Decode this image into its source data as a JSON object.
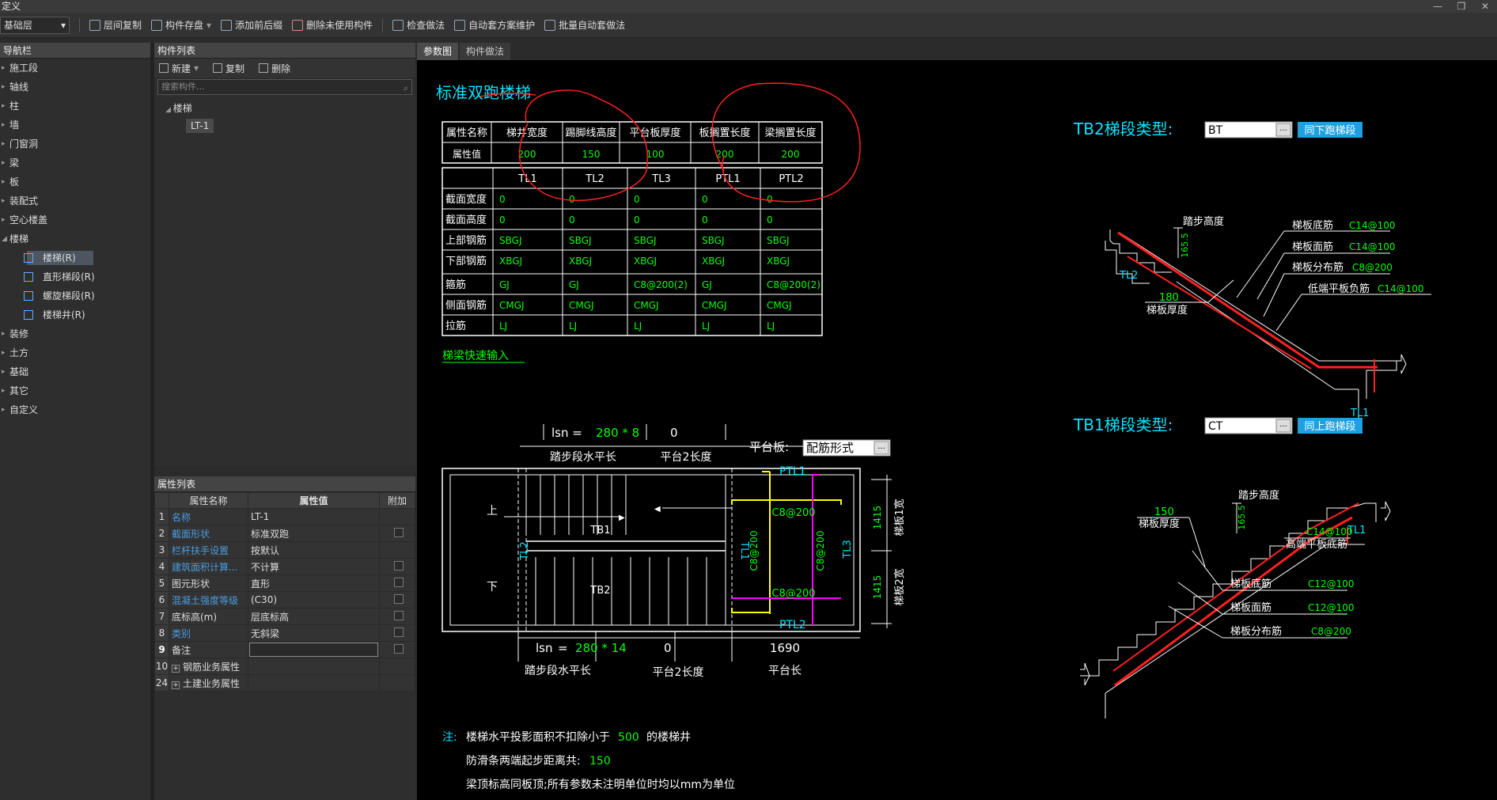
{
  "window": {
    "title": "定义",
    "buttons": [
      "—",
      "❐",
      "✕"
    ]
  },
  "toolbar": {
    "floor": "基础层",
    "buttons": [
      "层间复制",
      "构件存盘",
      "添加前后缀",
      "删除未使用构件",
      "检查做法",
      "自动套方案维护",
      "批量自动套做法"
    ]
  },
  "nav": {
    "title": "导航栏",
    "items": [
      "施工段",
      "轴线",
      "柱",
      "墙",
      "门窗洞",
      "梁",
      "板",
      "装配式",
      "空心楼盖",
      "楼梯"
    ],
    "stair_children": [
      "楼梯(R)",
      "直形梯段(R)",
      "螺旋梯段(R)",
      "楼梯井(R)"
    ],
    "items_after": [
      "装修",
      "土方",
      "基础",
      "其它",
      "自定义"
    ]
  },
  "components": {
    "title": "构件列表",
    "new": "新建",
    "copy": "复制",
    "delete": "删除",
    "search_placeholder": "搜索构件...",
    "tree_root": "楼梯",
    "tree_child": "LT-1"
  },
  "attributes": {
    "title": "属性列表",
    "col_name": "属性名称",
    "col_value": "属性值",
    "col_extra": "附加",
    "rows": [
      {
        "n": "1",
        "name": "名称",
        "value": "LT-1",
        "blue": true,
        "cb": false
      },
      {
        "n": "2",
        "name": "截面形状",
        "value": "标准双跑",
        "blue": true,
        "cb": true
      },
      {
        "n": "3",
        "name": "栏杆扶手设置",
        "value": "按默认",
        "blue": true,
        "cb": false
      },
      {
        "n": "4",
        "name": "建筑面积计算...",
        "value": "不计算",
        "blue": true,
        "cb": true
      },
      {
        "n": "5",
        "name": "图元形状",
        "value": "直形",
        "blue": false,
        "cb": true
      },
      {
        "n": "6",
        "name": "混凝土强度等级",
        "value": "(C30)",
        "blue": true,
        "cb": true
      },
      {
        "n": "7",
        "name": "底标高(m)",
        "value": "层底标高",
        "blue": false,
        "cb": true
      },
      {
        "n": "8",
        "name": "类别",
        "value": "无斜梁",
        "blue": true,
        "cb": true
      },
      {
        "n": "9",
        "name": "备注",
        "value": "",
        "blue": false,
        "cb": true
      },
      {
        "n": "10",
        "name": "钢筋业务属性",
        "value": "",
        "blue": false,
        "cb": false
      },
      {
        "n": "24",
        "name": "土建业务属性",
        "value": "",
        "blue": false,
        "cb": false
      }
    ]
  },
  "tabs": [
    "参数图",
    "构件做法"
  ],
  "drawing": {
    "title": "标准双跑楼梯",
    "param_headers": [
      "属性名称",
      "梯井宽度",
      "踢脚线高度",
      "平台板厚度",
      "板搁置长度",
      "梁搁置长度"
    ],
    "param_values": [
      "属性值",
      "200",
      "150",
      "100",
      "200",
      "200"
    ],
    "beam_headers": [
      "",
      "TL1",
      "TL2",
      "TL3",
      "PTL1",
      "PTL2"
    ],
    "beam_rows": [
      [
        "截面宽度",
        "0",
        "0",
        "0",
        "0",
        "0"
      ],
      [
        "截面高度",
        "0",
        "0",
        "0",
        "0",
        "0"
      ],
      [
        "上部钢筋",
        "SBGJ",
        "SBGJ",
        "SBGJ",
        "SBGJ",
        "SBGJ"
      ],
      [
        "下部钢筋",
        "XBGJ",
        "XBGJ",
        "XBGJ",
        "XBGJ",
        "XBGJ"
      ],
      [
        "箍筋",
        "GJ",
        "GJ",
        "C8@200(2)",
        "GJ",
        "C8@200(2)"
      ],
      [
        "侧面钢筋",
        "CMGJ",
        "CMGJ",
        "CMGJ",
        "CMGJ",
        "CMGJ"
      ],
      [
        "拉筋",
        "LJ",
        "LJ",
        "LJ",
        "LJ",
        "LJ"
      ]
    ],
    "quick_input": "梯梁快速输入",
    "plan": {
      "lsn_label": "lsn =",
      "lsn_top": "280 * 8",
      "pl2_top": "0",
      "seg_h": "踏步段水平长",
      "pl2_len": "平台2长度",
      "platform_label": "平台板:",
      "platform_value": "配筋形式",
      "up": "上",
      "down": "下",
      "tb1": "TB1",
      "tb2": "TB2",
      "tl2": "TL2",
      "tl1": "TL1",
      "tl3": "TL3",
      "ptl1": "PTL1",
      "ptl2": "PTL2",
      "c8a": "C8@200",
      "c8b": "C8@200",
      "c8v1": "C8@200",
      "c8v2": "C8@200",
      "w1": "1415",
      "w2": "1415",
      "wb1": "梯板1宽",
      "wb2": "梯板2宽",
      "lsn_bot": "280 * 14",
      "pl2_bot": "0",
      "plat_len_val": "1690",
      "plat_len": "平台长"
    },
    "tb2": {
      "label": "TB2梯段类型:",
      "value": "BT",
      "btn": "同下跑梯段",
      "step_h": "踏步高度",
      "dim": "165.5",
      "thick_val": "180",
      "thick": "梯板厚度",
      "l1": "梯板底筋",
      "v1": "C14@100",
      "l2": "梯板面筋",
      "v2": "C14@100",
      "l3": "梯板分布筋",
      "v3": "C8@200",
      "l4": "低端平板负筋",
      "v4": "C14@100",
      "tl2": "TL2",
      "tl1": "TL1"
    },
    "tb1": {
      "label": "TB1梯段类型:",
      "value": "CT",
      "btn": "同上跑梯段",
      "step_h": "踏步高度",
      "dim": "165.5",
      "thick_val": "150",
      "thick": "梯板厚度",
      "top_v": "C14@100",
      "top_l": "高端平板底筋",
      "l1": "梯板底筋",
      "v1": "C12@100",
      "l2": "梯板面筋",
      "v2": "C12@100",
      "l3": "梯板分布筋",
      "v3": "C8@200",
      "tl1": "TL1"
    },
    "notes": {
      "label": "注:",
      "n1a": "楼梯水平投影面积不扣除小于",
      "n1b": "500",
      "n1c": "的楼梯井",
      "n2a": "防滑条两端起步距离共:",
      "n2b": "150",
      "n3": "梁顶标高同板顶;所有参数未注明单位时均以mm为单位"
    }
  },
  "colors": {
    "cyan": "#00e5ff",
    "green": "#00ff00",
    "white": "#ffffff",
    "red": "#ff2020",
    "yellow": "#ffff00",
    "magenta": "#ff00ff"
  }
}
